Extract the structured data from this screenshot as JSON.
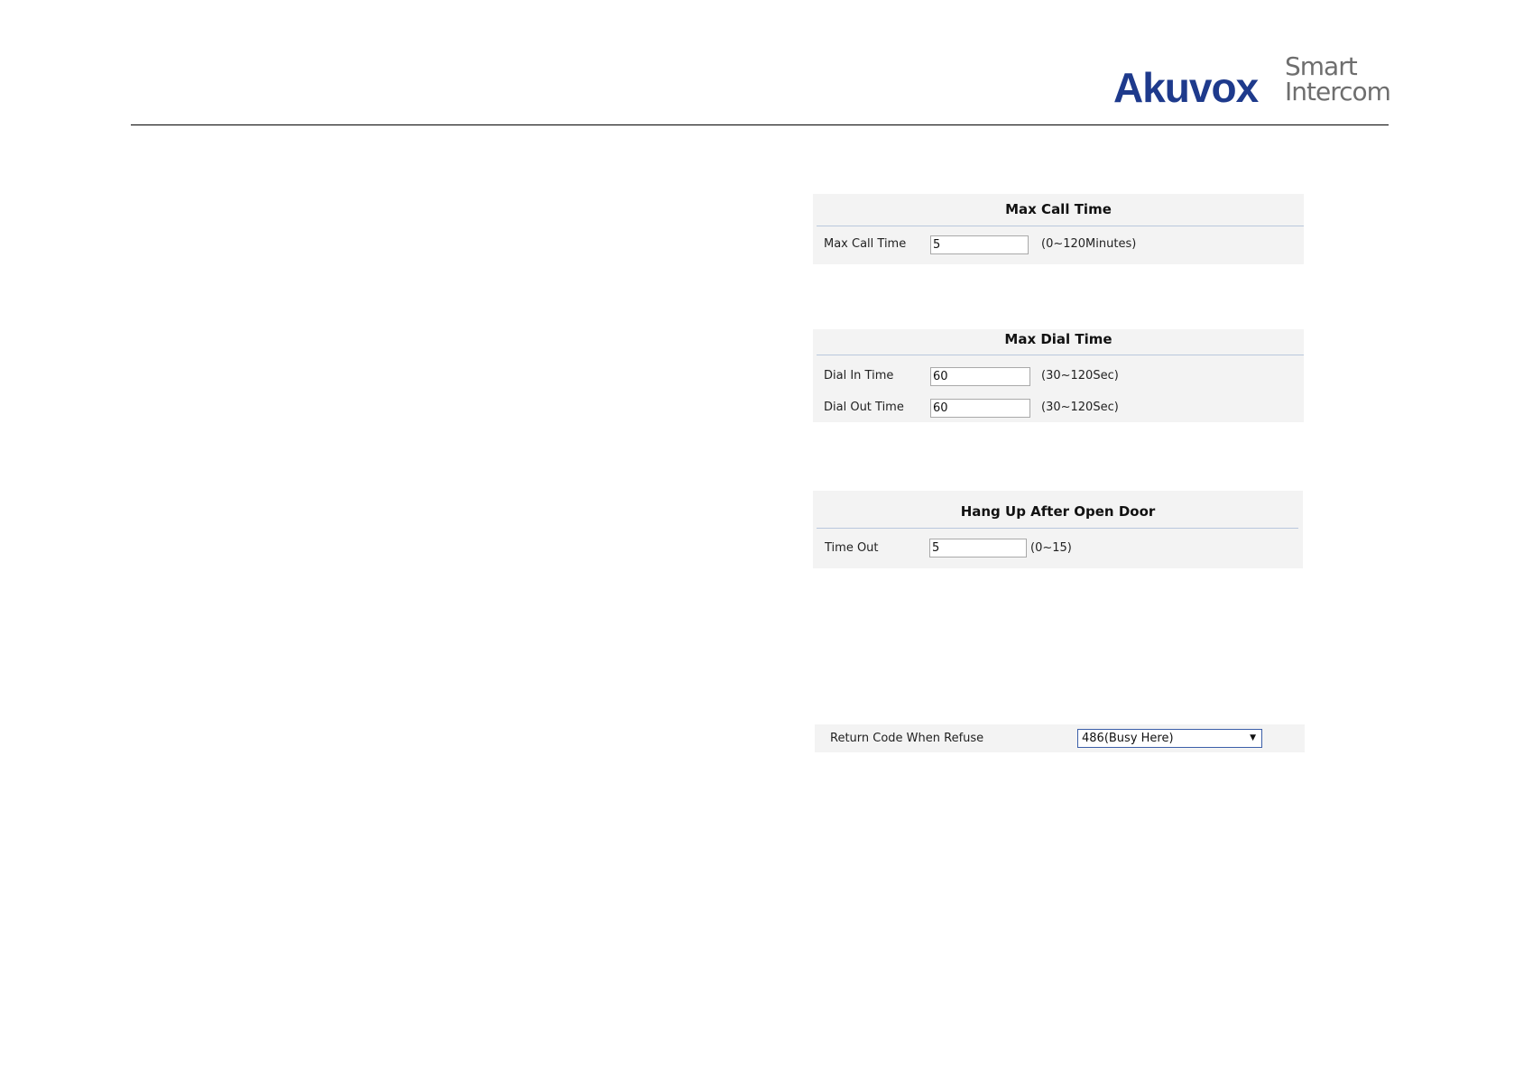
{
  "header": {
    "brand": "Akuvox",
    "tagline_line1": "Smart",
    "tagline_line2": "Intercom"
  },
  "max_call_time": {
    "title": "Max Call Time",
    "label": "Max Call Time",
    "value": "5",
    "range": "(0~120Minutes)"
  },
  "max_dial_time": {
    "title": "Max Dial Time",
    "dial_in_label": "Dial In Time",
    "dial_in_value": "60",
    "dial_in_range": "(30~120Sec)",
    "dial_out_label": "Dial Out Time",
    "dial_out_value": "60",
    "dial_out_range": "(30~120Sec)"
  },
  "hang_up": {
    "title": "Hang Up After Open Door",
    "label": "Time Out",
    "value": "5",
    "range": "(0~15)"
  },
  "return_code": {
    "label": "Return Code When Refuse",
    "selected": "486(Busy Here)",
    "arrow_icon": "dropdown-arrow-icon"
  }
}
